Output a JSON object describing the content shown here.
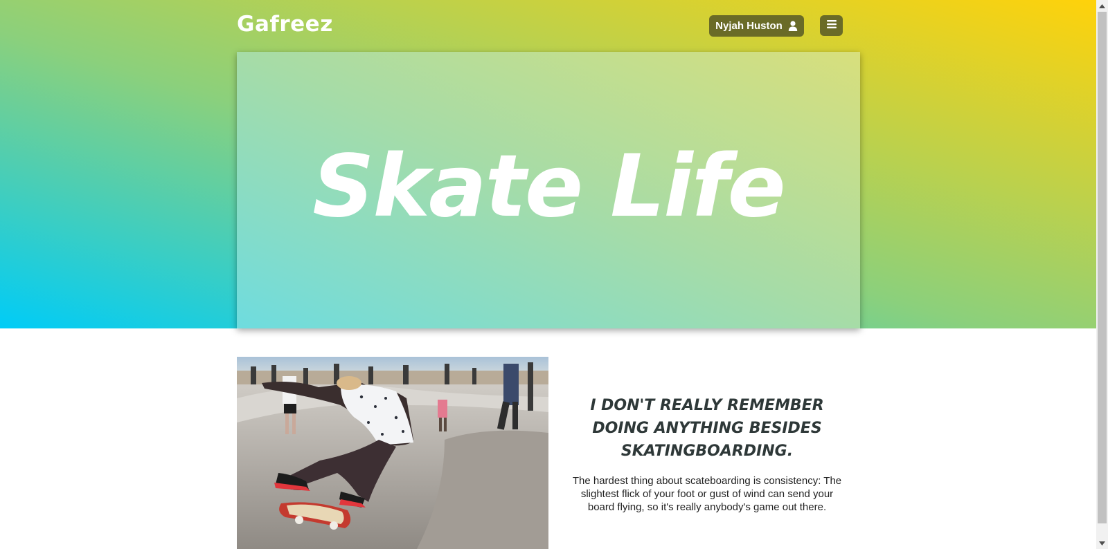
{
  "header": {
    "brand": "Gafreez",
    "user_name": "Nyjah Huston",
    "user_icon": "user-icon",
    "menu_icon": "hamburger-menu-icon"
  },
  "hero": {
    "title": "Skate Life"
  },
  "feature": {
    "image_icon": "skateboarder-photo",
    "heading": "I DON'T REALLY REMEMBER DOING ANYTHING BESIDES SKATINGBOARDING.",
    "text": "The hardest thing about scateboarding is consistency: The slightest flick of your foot or gust of wind can send your board flying, so it's really anybody's game out there."
  },
  "colors": {
    "gradient_start": "#00ccf7",
    "gradient_mid": "#8bd07c",
    "gradient_end": "#ffd20a",
    "button_bg": "#6a6b27",
    "heading_text": "#2e3838"
  }
}
